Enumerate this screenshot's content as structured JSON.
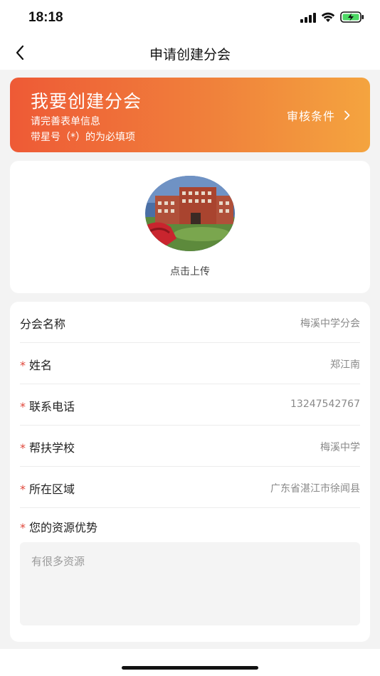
{
  "status_bar": {
    "time": "18:18",
    "signal_icon": "cellular-signal-icon",
    "wifi_icon": "wifi-icon",
    "battery_icon": "battery-charging-icon"
  },
  "nav": {
    "title": "申请创建分会",
    "back_icon": "chevron-left-icon"
  },
  "banner": {
    "title": "我要创建分会",
    "subtitle_1": "请完善表单信息",
    "subtitle_2": "带星号（*）的为必填项",
    "link_label": "审核条件",
    "link_icon": "chevron-right-icon",
    "gradient_start": "#ee5a36",
    "gradient_end": "#f4a43f"
  },
  "upload": {
    "label": "点击上传"
  },
  "form": {
    "required_mark": "*",
    "rows": [
      {
        "label": "分会名称",
        "value": "梅溪中学分会",
        "required": false
      },
      {
        "label": "姓名",
        "value": "郑江南",
        "required": true
      },
      {
        "label": "联系电话",
        "value": "13247542767",
        "required": true
      },
      {
        "label": "帮扶学校",
        "value": "梅溪中学",
        "required": true
      },
      {
        "label": "所在区域",
        "value": "广东省湛江市徐闻县",
        "required": true
      }
    ],
    "resources_label": "您的资源优势",
    "resources_placeholder": "有很多资源"
  },
  "colors": {
    "accent": "#ee5a36",
    "required_star": "#e0473a",
    "page_bg": "#f3f3f3"
  }
}
